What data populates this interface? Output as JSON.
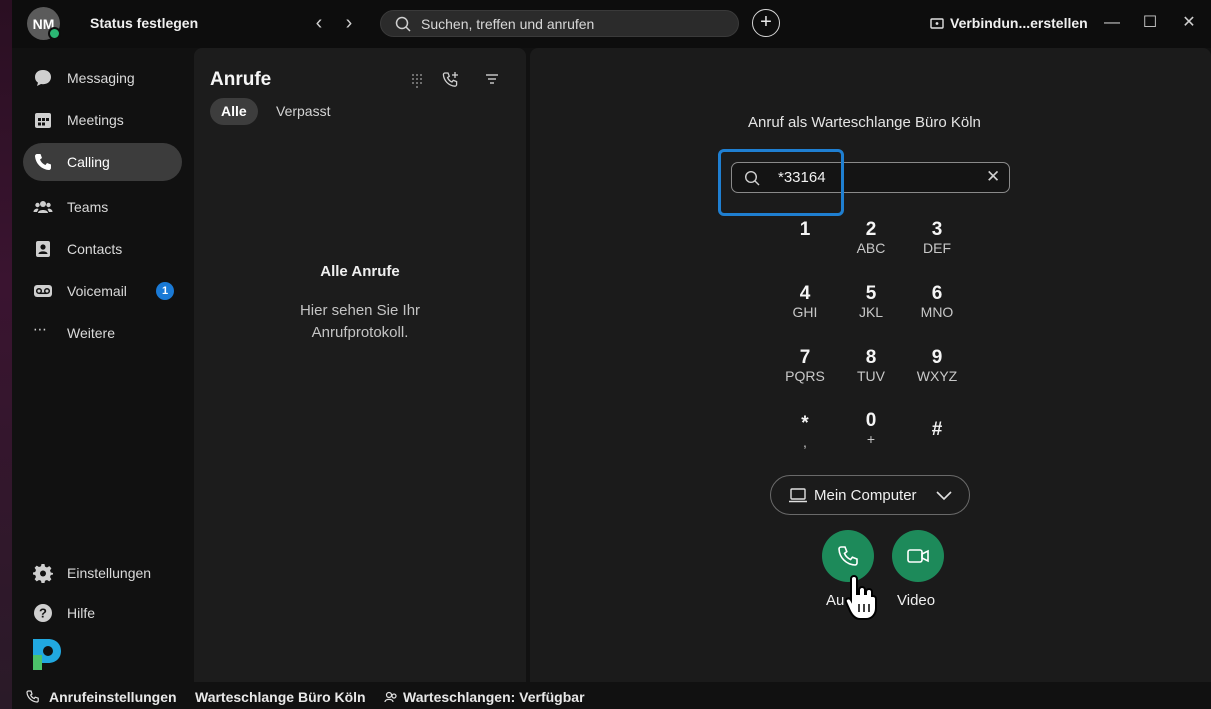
{
  "titlebar": {
    "avatar_initials": "NM",
    "status_label": "Status festlegen",
    "search_placeholder": "Suchen, treffen und anrufen",
    "connect_label": "Verbindun...erstellen"
  },
  "sidebar": {
    "items": [
      {
        "label": "Messaging",
        "icon": "chat-bubble-icon"
      },
      {
        "label": "Meetings",
        "icon": "calendar-icon"
      },
      {
        "label": "Calling",
        "icon": "phone-icon",
        "active": true
      },
      {
        "label": "Teams",
        "icon": "people-icon"
      },
      {
        "label": "Contacts",
        "icon": "contact-card-icon"
      },
      {
        "label": "Voicemail",
        "icon": "voicemail-icon",
        "badge": "1"
      },
      {
        "label": "Weitere",
        "icon": "more-dots-icon"
      }
    ],
    "bottom_items": [
      {
        "label": "Einstellungen",
        "icon": "gear-icon"
      },
      {
        "label": "Hilfe",
        "icon": "help-icon"
      }
    ]
  },
  "calls": {
    "title": "Anrufe",
    "filter_all": "Alle",
    "filter_missed": "Verpasst",
    "empty_title": "Alle Anrufe",
    "empty_desc": "Hier sehen Sie Ihr Anrufprotokoll."
  },
  "dialer": {
    "queue_label": "Anruf als Warteschlange Büro Köln",
    "input_value": "*33164",
    "keys": [
      {
        "digit": "1",
        "letters": ""
      },
      {
        "digit": "2",
        "letters": "ABC"
      },
      {
        "digit": "3",
        "letters": "DEF"
      },
      {
        "digit": "4",
        "letters": "GHI"
      },
      {
        "digit": "5",
        "letters": "JKL"
      },
      {
        "digit": "6",
        "letters": "MNO"
      },
      {
        "digit": "7",
        "letters": "PQRS"
      },
      {
        "digit": "8",
        "letters": "TUV"
      },
      {
        "digit": "9",
        "letters": "WXYZ"
      },
      {
        "digit": "*",
        "letters": ","
      },
      {
        "digit": "0",
        "letters": "+"
      },
      {
        "digit": "#",
        "letters": ""
      }
    ],
    "device_label": "Mein Computer",
    "audio_label": "Au",
    "video_label": "Video",
    "accent_color": "#1d8a5a",
    "focus_color": "#1f7fd1"
  },
  "statusbar": {
    "call_settings": "Anrufeinstellungen",
    "queue_name": "Warteschlange Büro Köln",
    "queue_status": "Warteschlangen: Verfügbar"
  }
}
